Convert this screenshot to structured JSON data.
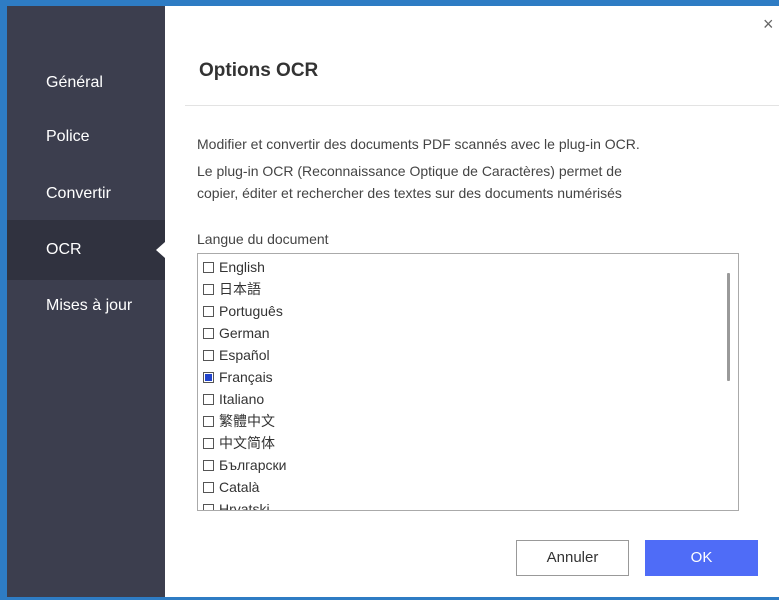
{
  "window": {
    "close_glyph": "×",
    "accent": "#2e7cc4"
  },
  "sidebar": {
    "background": "#3c3e4e",
    "items": [
      {
        "label": "Général",
        "active": false
      },
      {
        "label": "Police",
        "active": false
      },
      {
        "label": "Convertir",
        "active": false
      },
      {
        "label": "OCR",
        "active": true
      },
      {
        "label": "Mises à jour",
        "active": false
      }
    ]
  },
  "main": {
    "title": "Options OCR",
    "description_line1": "Modifier et convertir des documents PDF scannés avec le plug-in OCR.",
    "description_line2": "Le plug-in OCR (Reconnaissance Optique de Caractères) permet de",
    "description_line3": "copier, éditer et rechercher des textes sur des documents numérisés",
    "language_label": "Langue du document",
    "languages": [
      {
        "name": "English",
        "checked": false
      },
      {
        "name": "日本語",
        "checked": false
      },
      {
        "name": "Português",
        "checked": false
      },
      {
        "name": "German",
        "checked": false
      },
      {
        "name": "Español",
        "checked": false
      },
      {
        "name": "Français",
        "checked": true
      },
      {
        "name": "Italiano",
        "checked": false
      },
      {
        "name": "繁體中文",
        "checked": false
      },
      {
        "name": "中文简体",
        "checked": false
      },
      {
        "name": "Български",
        "checked": false
      },
      {
        "name": "Català",
        "checked": false
      },
      {
        "name": "Hrvatski",
        "checked": false
      }
    ]
  },
  "buttons": {
    "cancel_label": "Annuler",
    "ok_label": "OK",
    "ok_color": "#4f6cf7"
  }
}
